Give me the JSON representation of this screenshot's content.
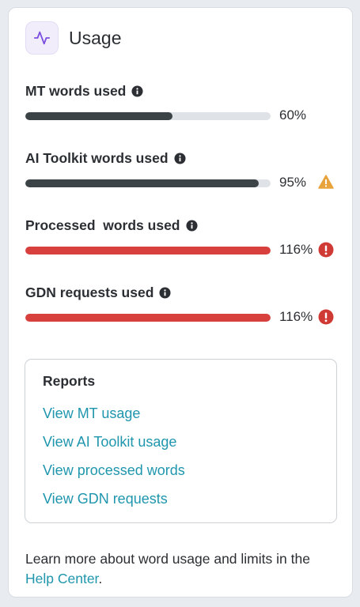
{
  "header": {
    "title": "Usage",
    "icon": "activity-icon",
    "accent": "#7b4fe0"
  },
  "metrics": [
    {
      "label": "MT words used",
      "percent_text": "60%",
      "fill_percent": 60,
      "status": "normal"
    },
    {
      "label": "AI Toolkit words used",
      "percent_text": "95%",
      "fill_percent": 95,
      "status": "warning"
    },
    {
      "label": "Processed  words used",
      "percent_text": "116%",
      "fill_percent": 100,
      "status": "error"
    },
    {
      "label": "GDN requests used",
      "percent_text": "116%",
      "fill_percent": 100,
      "status": "error"
    }
  ],
  "colors": {
    "normal_fill": "#3c4346",
    "over_fill": "#d8403e",
    "warning": "#e8a33c",
    "error": "#d03a35",
    "link": "#1f96ad"
  },
  "reports": {
    "title": "Reports",
    "links": [
      "View MT usage",
      "View AI Toolkit usage",
      "View processed words",
      "View GDN requests"
    ]
  },
  "footer": {
    "text": "Learn more about word usage and limits in the ",
    "link": "Help Center",
    "end": "."
  }
}
